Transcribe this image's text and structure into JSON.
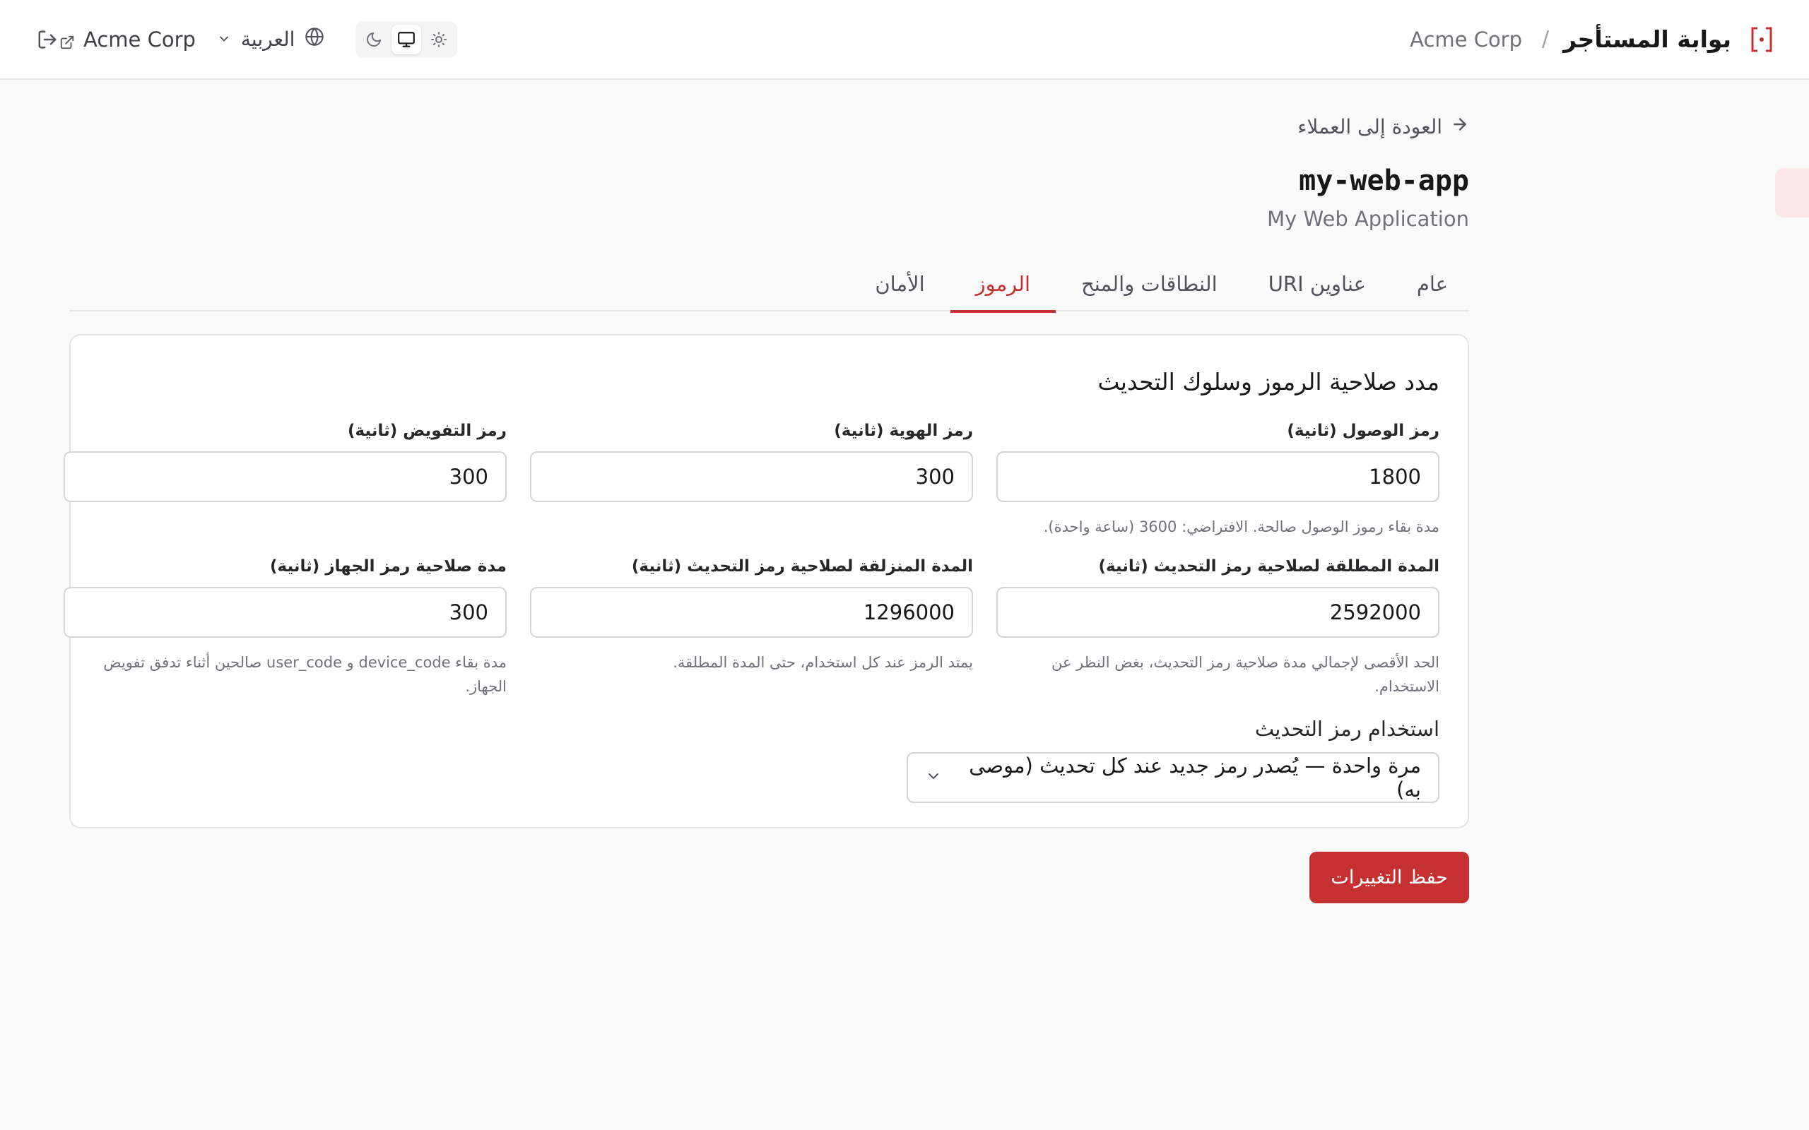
{
  "header": {
    "portal_title": "بوابة المستأجر",
    "separator": "/",
    "tenant_crumb": "Acme Corp",
    "tenant_link": "Acme Corp",
    "language": "العربية"
  },
  "page": {
    "back_label": "العودة إلى العملاء",
    "client_id": "my-web-app",
    "client_name": "My Web Application"
  },
  "tabs": [
    {
      "label": "عام"
    },
    {
      "label": "عناوين URI"
    },
    {
      "label": "النطاقات والمنح"
    },
    {
      "label": "الرموز",
      "active": true
    },
    {
      "label": "الأمان"
    }
  ],
  "card": {
    "title": "مدد صلاحية الرموز وسلوك التحديث",
    "fields": {
      "access_token": {
        "label": "رمز الوصول (ثانية)",
        "value": "1800",
        "hint": "مدة بقاء رموز الوصول صالحة. الافتراضي: 3600 (ساعة واحدة)."
      },
      "id_token": {
        "label": "رمز الهوية (ثانية)",
        "value": "300"
      },
      "auth_code": {
        "label": "رمز التفويض (ثانية)",
        "value": "300"
      },
      "refresh_absolute": {
        "label": "المدة المطلقة لصلاحية رمز التحديث (ثانية)",
        "value": "2592000",
        "hint": "الحد الأقصى لإجمالي مدة صلاحية رمز التحديث، بغض النظر عن الاستخدام."
      },
      "refresh_sliding": {
        "label": "المدة المنزلقة لصلاحية رمز التحديث (ثانية)",
        "value": "1296000",
        "hint": "يمتد الرمز عند كل استخدام، حتى المدة المطلقة."
      },
      "device_code": {
        "label": "مدة صلاحية رمز الجهاز (ثانية)",
        "value": "300",
        "hint": "مدة بقاء device_code و user_code صالحين أثناء تدفق تفويض الجهاز."
      }
    },
    "refresh_usage": {
      "label": "استخدام رمز التحديث",
      "selected": "مرة واحدة — يُصدر رمز جديد عند كل تحديث (موصى به)"
    }
  },
  "actions": {
    "save_label": "حفظ التغييرات"
  },
  "colors": {
    "accent": "#c53030",
    "border": "#e4e4e7"
  }
}
